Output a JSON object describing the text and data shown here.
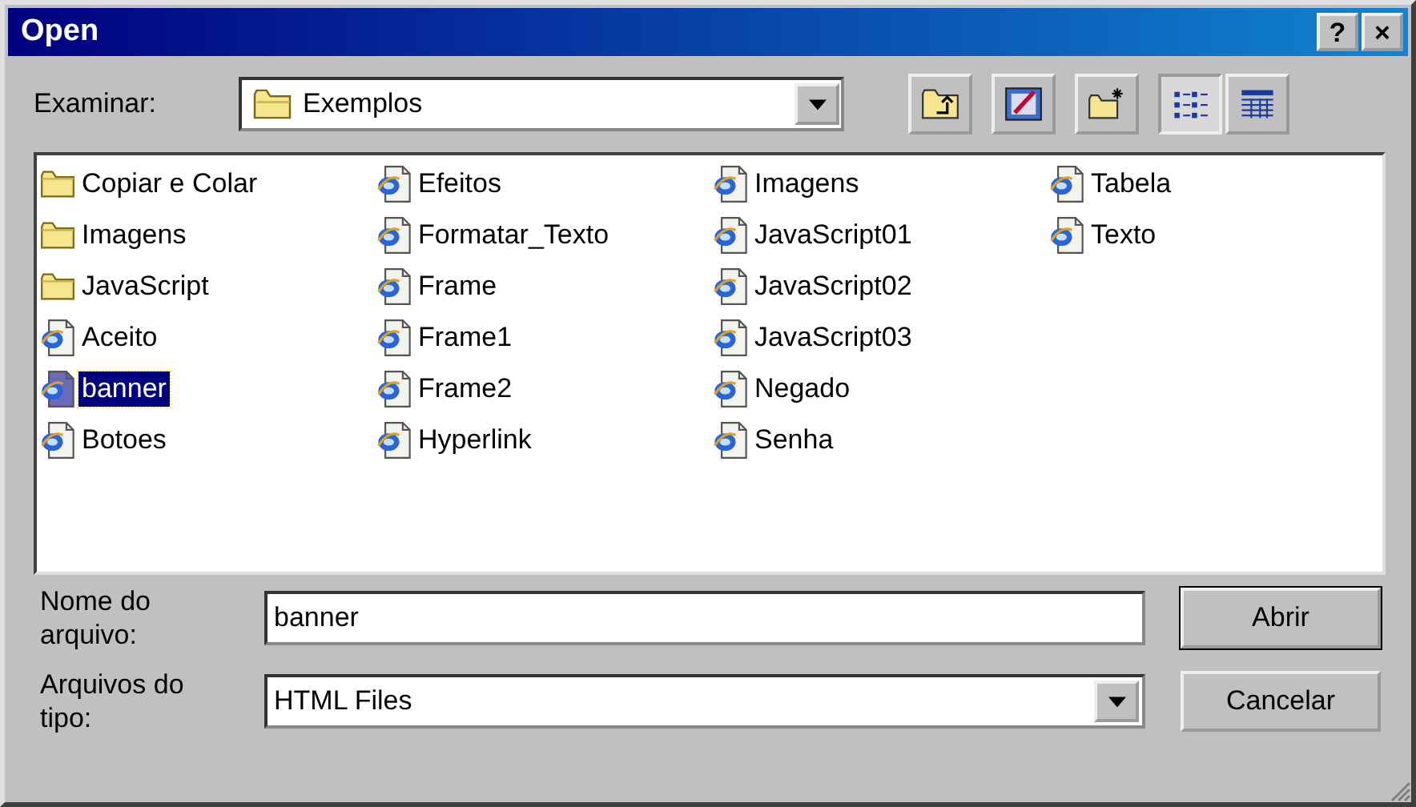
{
  "window": {
    "title": "Open"
  },
  "title_buttons": [
    "?",
    "×"
  ],
  "look_in": {
    "label": "Examinar:",
    "value": "Exemplos"
  },
  "files": [
    {
      "name": "Copiar e Colar",
      "kind": "folder",
      "selected": false
    },
    {
      "name": "Imagens",
      "kind": "folder",
      "selected": false
    },
    {
      "name": "JavaScript",
      "kind": "folder",
      "selected": false
    },
    {
      "name": "Aceito",
      "kind": "html",
      "selected": false
    },
    {
      "name": "banner",
      "kind": "html",
      "selected": true
    },
    {
      "name": "Botoes",
      "kind": "html",
      "selected": false
    },
    {
      "name": "Efeitos",
      "kind": "html",
      "selected": false
    },
    {
      "name": "Formatar_Texto",
      "kind": "html",
      "selected": false
    },
    {
      "name": "Frame",
      "kind": "html",
      "selected": false
    },
    {
      "name": "Frame1",
      "kind": "html",
      "selected": false
    },
    {
      "name": "Frame2",
      "kind": "html",
      "selected": false
    },
    {
      "name": "Hyperlink",
      "kind": "html",
      "selected": false
    },
    {
      "name": "Imagens",
      "kind": "html",
      "selected": false
    },
    {
      "name": "JavaScript01",
      "kind": "html",
      "selected": false
    },
    {
      "name": "JavaScript02",
      "kind": "html",
      "selected": false
    },
    {
      "name": "JavaScript03",
      "kind": "html",
      "selected": false
    },
    {
      "name": "Negado",
      "kind": "html",
      "selected": false
    },
    {
      "name": "Senha",
      "kind": "html",
      "selected": false
    },
    {
      "name": "Tabela",
      "kind": "html",
      "selected": false
    },
    {
      "name": "Texto",
      "kind": "html",
      "selected": false
    }
  ],
  "file_name": {
    "label": "Nome do arquivo:",
    "value": "banner"
  },
  "file_type": {
    "label": "Arquivos do tipo:",
    "value": "HTML Files"
  },
  "buttons": [
    "Abrir",
    "Cancelar"
  ]
}
